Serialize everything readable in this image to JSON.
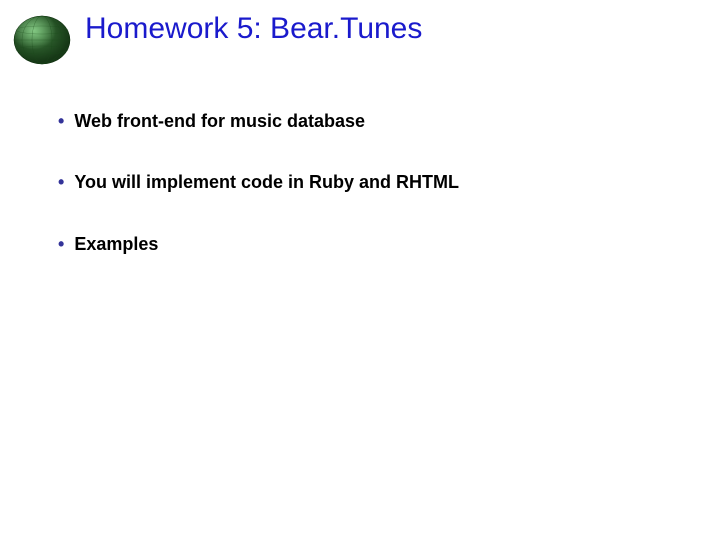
{
  "title": "Homework 5: Bear.Tunes",
  "bullets": [
    "Web front-end for music database",
    "You will implement code in Ruby and RHTML",
    "Examples"
  ],
  "colors": {
    "title": "#1a1acc",
    "bullet": "#333399",
    "text": "#000000"
  }
}
